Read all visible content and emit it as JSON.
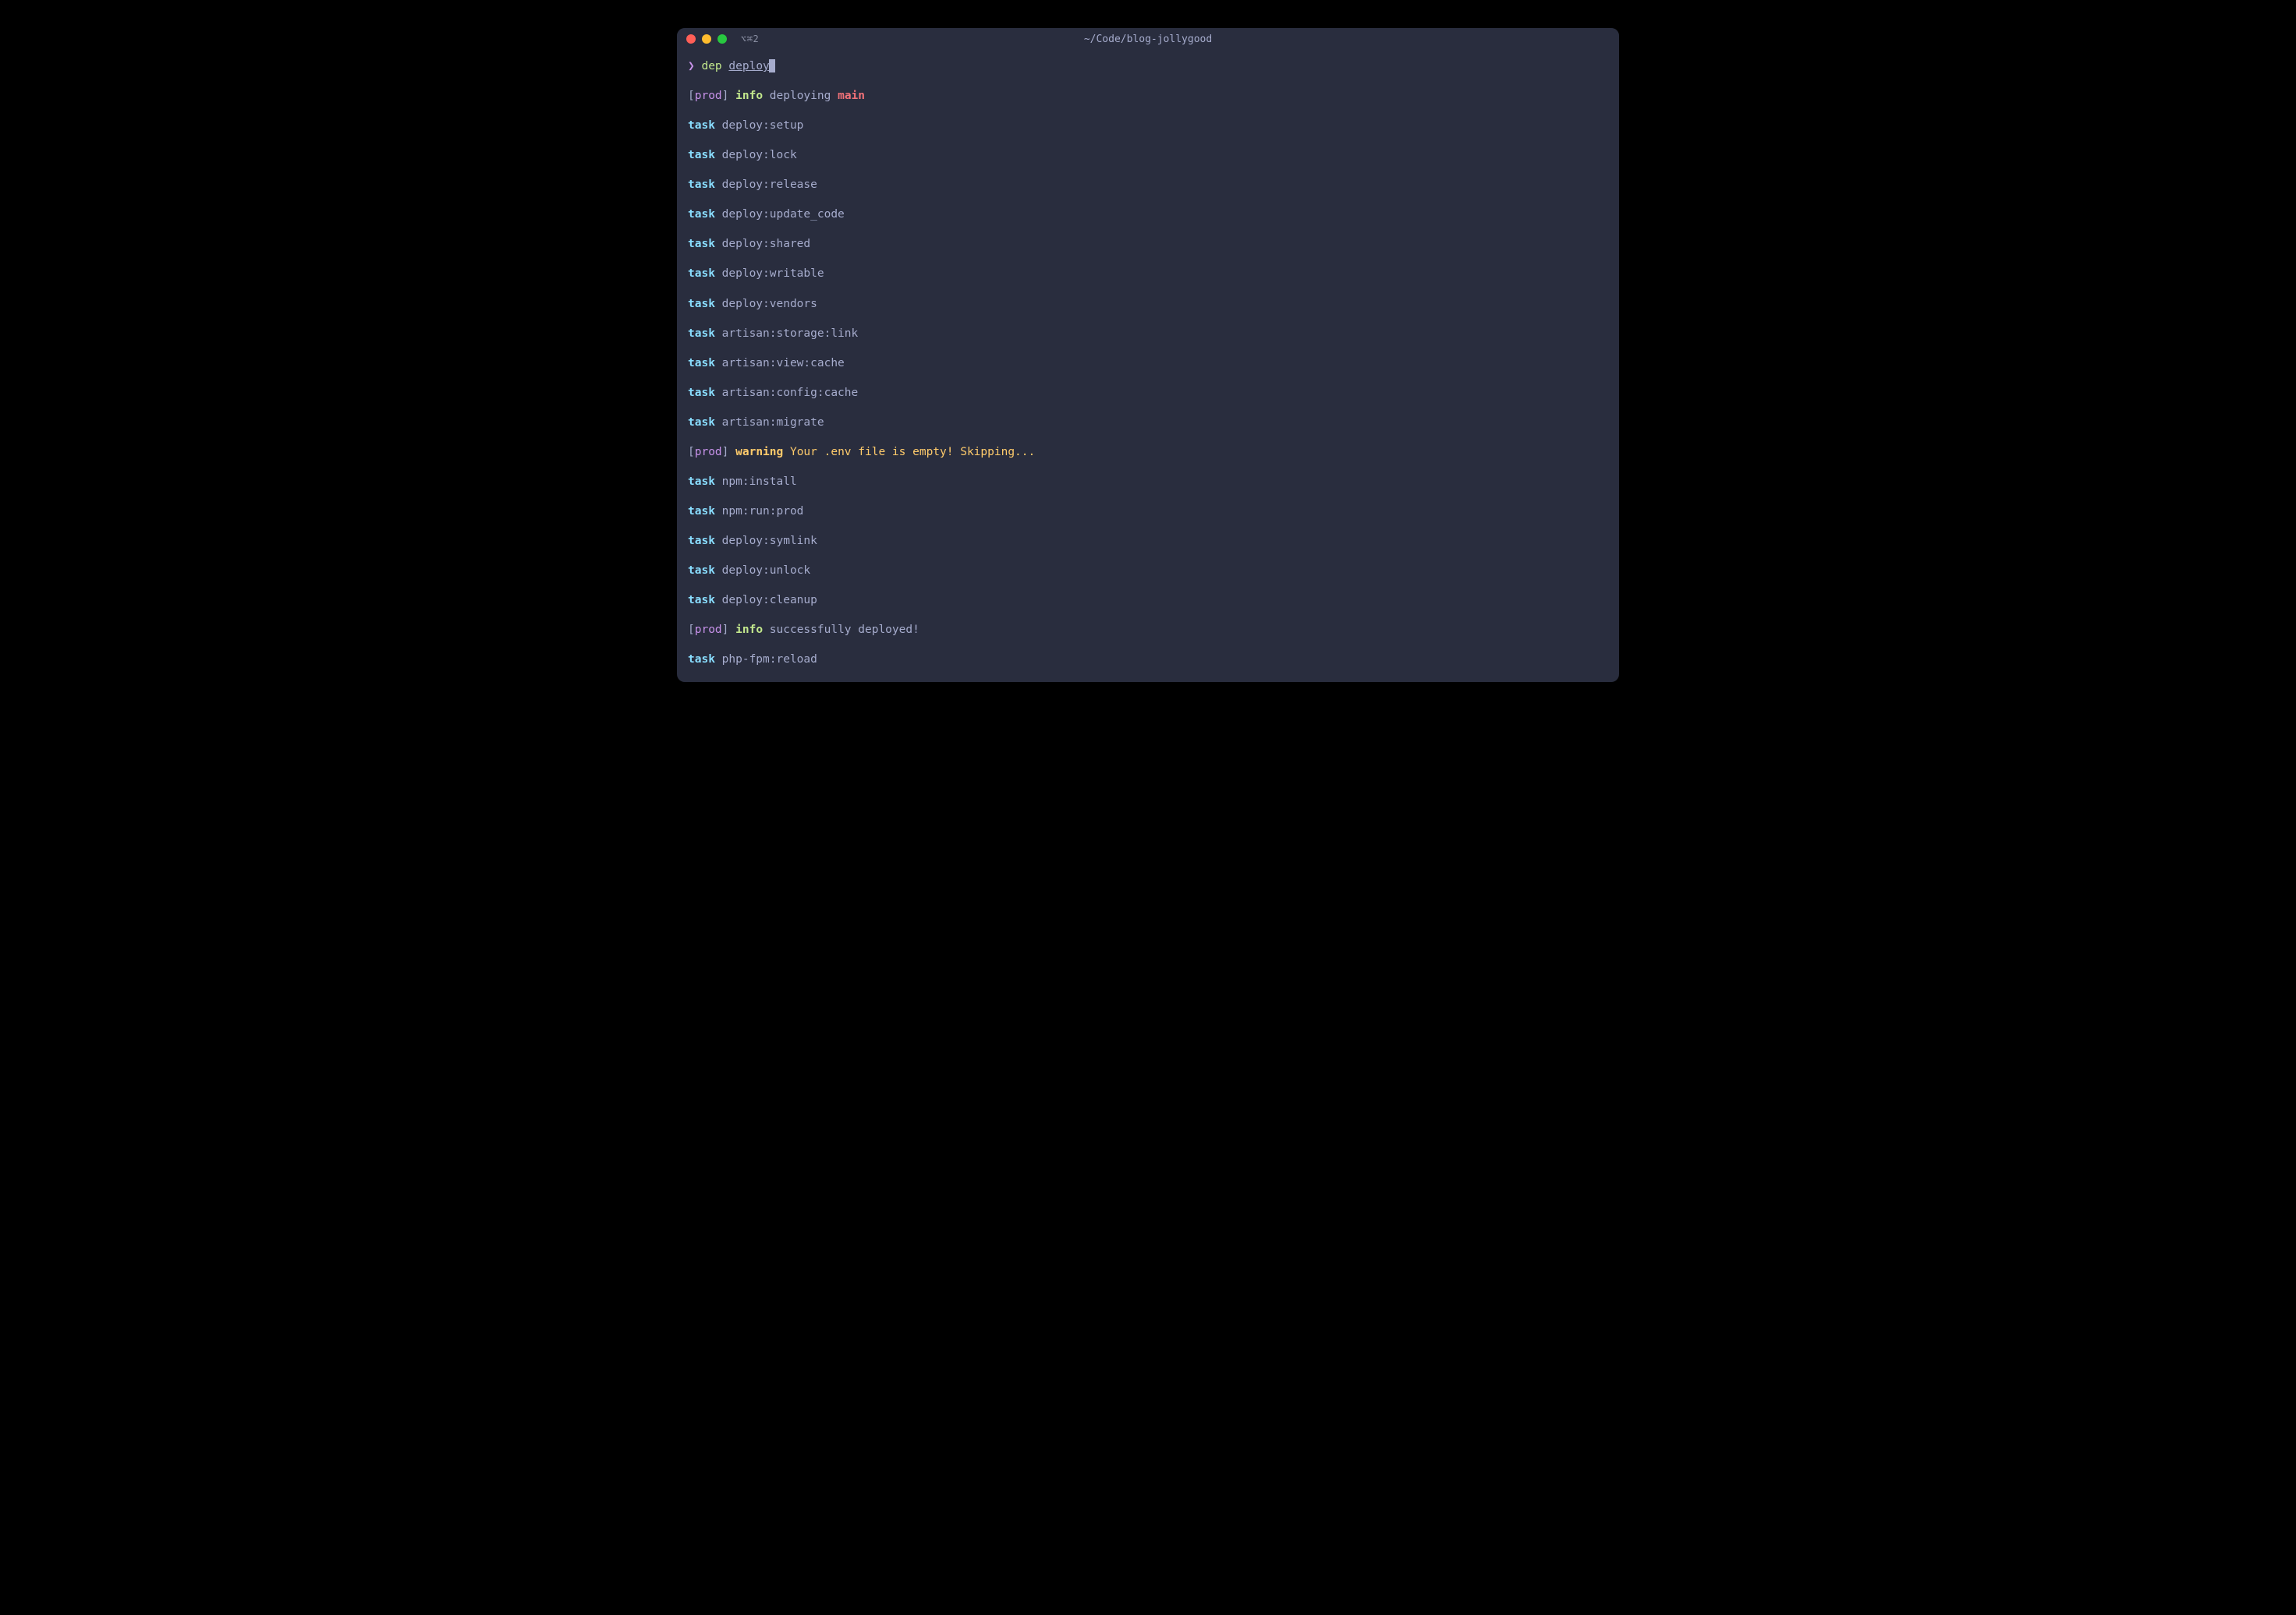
{
  "window": {
    "title": "~/Code/blog-jollygood",
    "tab_indicator": "⌥⌘2"
  },
  "prompt": {
    "caret": "❯",
    "cmd": "dep",
    "arg": "deploy"
  },
  "lines": [
    {
      "type": "info",
      "host": "prod",
      "level": "info",
      "text": "deploying",
      "branch": "main"
    },
    {
      "type": "task",
      "name": "deploy:setup"
    },
    {
      "type": "task",
      "name": "deploy:lock"
    },
    {
      "type": "task",
      "name": "deploy:release"
    },
    {
      "type": "task",
      "name": "deploy:update_code"
    },
    {
      "type": "task",
      "name": "deploy:shared"
    },
    {
      "type": "task",
      "name": "deploy:writable"
    },
    {
      "type": "task",
      "name": "deploy:vendors"
    },
    {
      "type": "task",
      "name": "artisan:storage:link"
    },
    {
      "type": "task",
      "name": "artisan:view:cache"
    },
    {
      "type": "task",
      "name": "artisan:config:cache"
    },
    {
      "type": "task",
      "name": "artisan:migrate"
    },
    {
      "type": "warn",
      "host": "prod",
      "level": "warning",
      "text": "Your .env file is empty! Skipping..."
    },
    {
      "type": "task",
      "name": "npm:install"
    },
    {
      "type": "task",
      "name": "npm:run:prod"
    },
    {
      "type": "task",
      "name": "deploy:symlink"
    },
    {
      "type": "task",
      "name": "deploy:unlock"
    },
    {
      "type": "task",
      "name": "deploy:cleanup"
    },
    {
      "type": "info",
      "host": "prod",
      "level": "info",
      "text": "successfully deployed!"
    },
    {
      "type": "task",
      "name": "php-fpm:reload"
    }
  ],
  "labels": {
    "task": "task"
  }
}
